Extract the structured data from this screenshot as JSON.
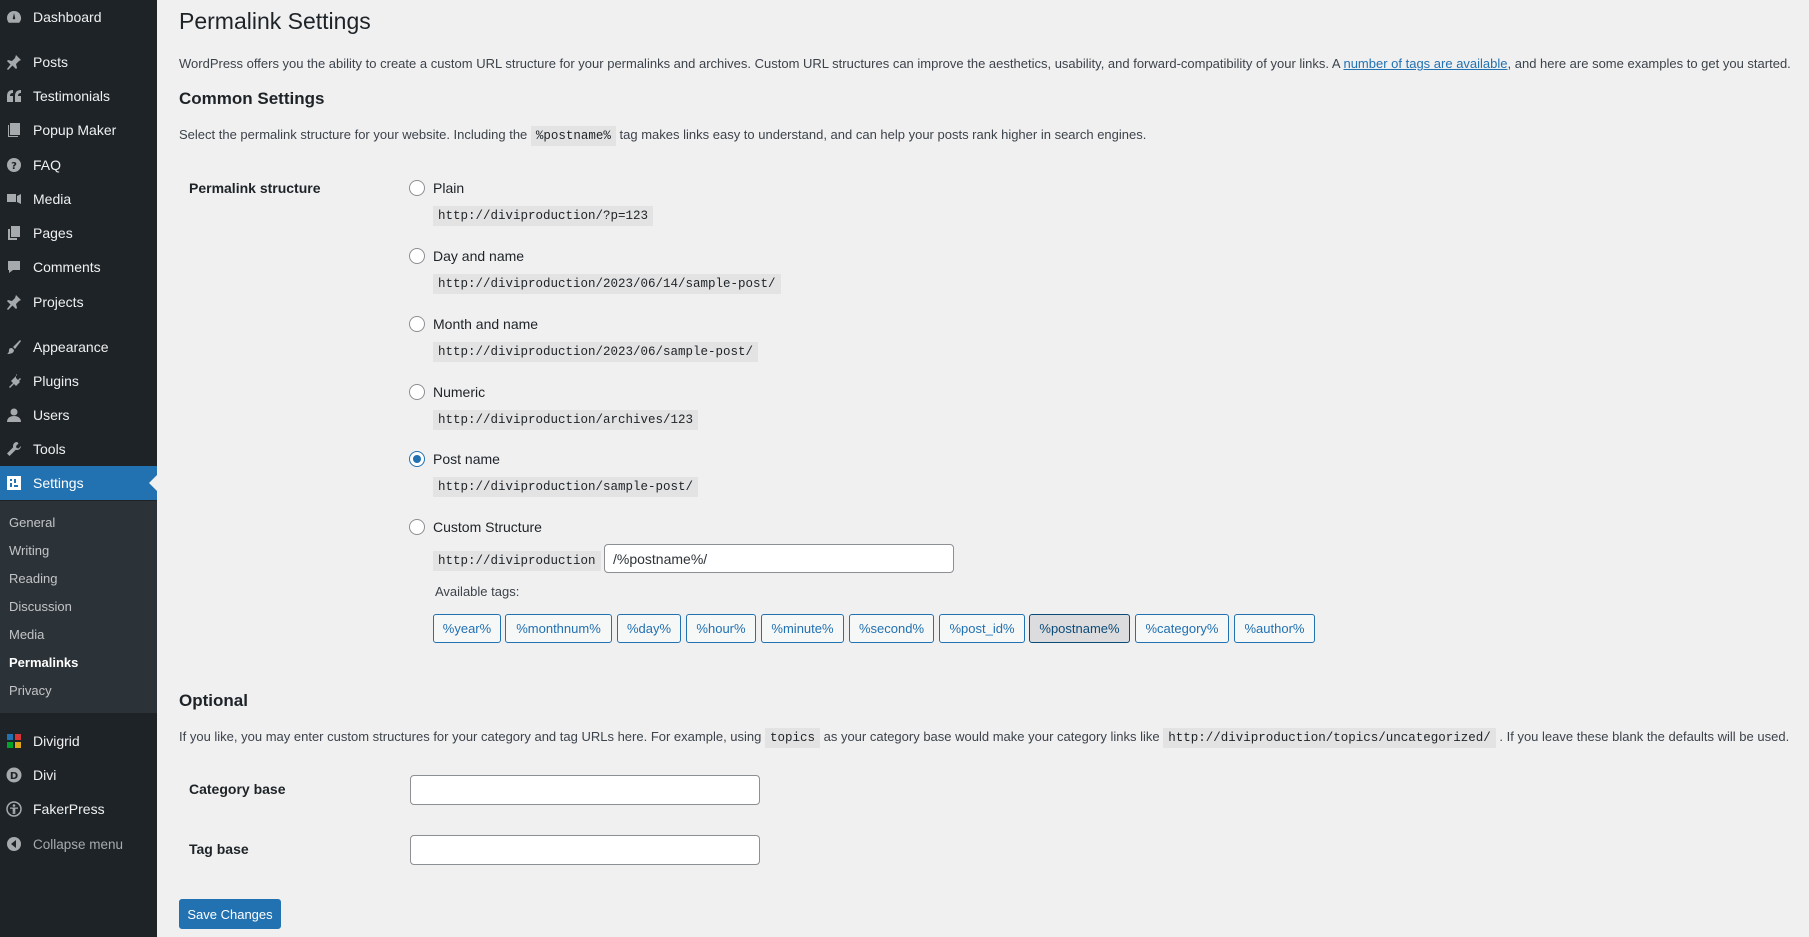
{
  "sidebar": {
    "items": [
      {
        "label": "Dashboard",
        "icon": "dashboard-icon"
      },
      {
        "label": "Posts",
        "icon": "pin-icon"
      },
      {
        "label": "Testimonials",
        "icon": "quote-icon"
      },
      {
        "label": "Popup Maker",
        "icon": "popup-icon"
      },
      {
        "label": "FAQ",
        "icon": "help-icon"
      },
      {
        "label": "Media",
        "icon": "media-icon"
      },
      {
        "label": "Pages",
        "icon": "pages-icon"
      },
      {
        "label": "Comments",
        "icon": "comments-icon"
      },
      {
        "label": "Projects",
        "icon": "pin-icon"
      },
      {
        "label": "Appearance",
        "icon": "brush-icon"
      },
      {
        "label": "Plugins",
        "icon": "plugin-icon"
      },
      {
        "label": "Users",
        "icon": "users-icon"
      },
      {
        "label": "Tools",
        "icon": "wrench-icon"
      },
      {
        "label": "Settings",
        "icon": "settings-icon"
      }
    ],
    "submenu": [
      "General",
      "Writing",
      "Reading",
      "Discussion",
      "Media",
      "Permalinks",
      "Privacy"
    ],
    "extra_items": [
      {
        "label": "Divigrid",
        "icon": "divigrid-icon"
      },
      {
        "label": "Divi",
        "icon": "divi-icon"
      },
      {
        "label": "FakerPress",
        "icon": "fakerpress-icon"
      }
    ],
    "collapse_label": "Collapse menu"
  },
  "page": {
    "title": "Permalink Settings",
    "intro_before": "WordPress offers you the ability to create a custom URL structure for your permalinks and archives. Custom URL structures can improve the aesthetics, usability, and forward-compatibility of your links. A ",
    "intro_link": "number of tags are available",
    "intro_after": ", and here are some examples to get you started."
  },
  "common": {
    "heading": "Common Settings",
    "desc_before": "Select the permalink structure for your website. Including the ",
    "desc_code": "%postname%",
    "desc_after": " tag makes links easy to understand, and can help your posts rank higher in search engines.",
    "field_label": "Permalink structure",
    "options": [
      {
        "label": "Plain",
        "example": "http://diviproduction/?p=123",
        "checked": false
      },
      {
        "label": "Day and name",
        "example": "http://diviproduction/2023/06/14/sample-post/",
        "checked": false
      },
      {
        "label": "Month and name",
        "example": "http://diviproduction/2023/06/sample-post/",
        "checked": false
      },
      {
        "label": "Numeric",
        "example": "http://diviproduction/archives/123",
        "checked": false
      },
      {
        "label": "Post name",
        "example": "http://diviproduction/sample-post/",
        "checked": true
      },
      {
        "label": "Custom Structure",
        "checked": false
      }
    ],
    "custom_prefix": "http://diviproduction",
    "custom_value": "/%postname%/",
    "available_tags_label": "Available tags:",
    "tags": [
      "%year%",
      "%monthnum%",
      "%day%",
      "%hour%",
      "%minute%",
      "%second%",
      "%post_id%",
      "%postname%",
      "%category%",
      "%author%"
    ],
    "active_tag": "%postname%"
  },
  "optional": {
    "heading": "Optional",
    "desc_before": "If you like, you may enter custom structures for your category and tag URLs here. For example, using ",
    "desc_code1": "topics",
    "desc_mid": " as your category base would make your category links like ",
    "desc_code2": "http://diviproduction/topics/uncategorized/",
    "desc_after": " . If you leave these blank the defaults will be used.",
    "category_base_label": "Category base",
    "category_base_value": "",
    "tag_base_label": "Tag base",
    "tag_base_value": ""
  },
  "save_label": "Save Changes",
  "colors": {
    "accent": "#2271b1",
    "sidebar_bg": "#1d2327",
    "submenu_bg": "#2c3338",
    "page_bg": "#f0f0f1"
  }
}
